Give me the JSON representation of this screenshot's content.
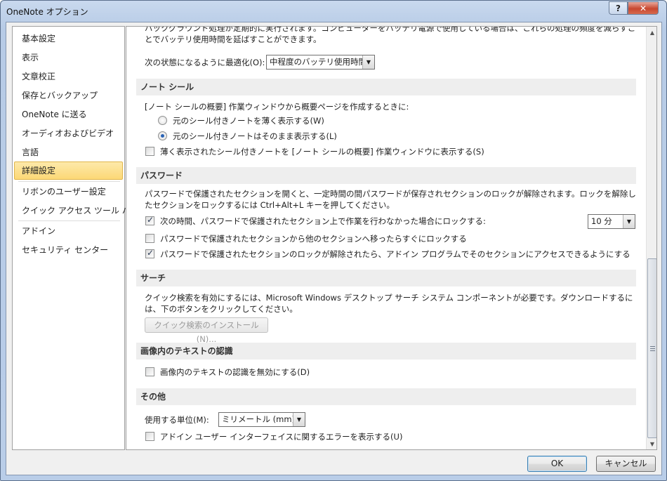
{
  "window": {
    "title": "OneNote オプション",
    "help_label": "?",
    "close_label": "✕"
  },
  "sidebar": {
    "items": [
      {
        "label": "基本設定"
      },
      {
        "label": "表示"
      },
      {
        "label": "文章校正"
      },
      {
        "label": "保存とバックアップ"
      },
      {
        "label": "OneNote に送る"
      },
      {
        "label": "オーディオおよびビデオ"
      },
      {
        "label": "言語"
      },
      {
        "label": "詳細設定",
        "selected": true
      },
      {
        "label": "リボンのユーザー設定"
      },
      {
        "label": "クイック アクセス ツール バー"
      },
      {
        "label": "アドイン"
      },
      {
        "label": "セキュリティ センター"
      }
    ]
  },
  "battery": {
    "partial_text": "バックグラウンド処理が定期的に実行されます。コンピューターをバッテリ電源で使用している場合は、これらの処理の頻度を減らすことでバッテリ使用時間を延ばすことができます。",
    "optimize_label": "次の状態になるように最適化(O):",
    "optimize_value": "中程度のバッテリ使用時間"
  },
  "note_seal": {
    "header": "ノート シール",
    "intro": "[ノート シールの概要] 作業ウィンドウから概要ページを作成するときに:",
    "radio_dim_label": "元のシール付きノートを薄く表示する(W)",
    "radio_keep_label": "元のシール付きノートはそのまま表示する(L)",
    "show_dimmed_label": "薄く表示されたシール付きノートを [ノート シールの概要] 作業ウィンドウに表示する(S)"
  },
  "password": {
    "header": "パスワード",
    "desc": "パスワードで保護されたセクションを開くと、一定時間の間パスワードが保存されセクションのロックが解除されます。ロックを解除したセクションをロックするには Ctrl+Alt+L キーを押してください。",
    "lock_after_label": "次の時間、パスワードで保護されたセクション上で作業を行わなかった場合にロックする:",
    "lock_after_value": "10 分",
    "lock_on_leave_label": "パスワードで保護されたセクションから他のセクションへ移ったらすぐにロックする",
    "addin_access_label": "パスワードで保護されたセクションのロックが解除されたら、アドイン プログラムでそのセクションにアクセスできるようにする"
  },
  "search": {
    "header": "サーチ",
    "desc": "クイック検索を有効にするには、Microsoft Windows デスクトップ サーチ システム コンポーネントが必要です。ダウンロードするには、下のボタンをクリックしてください。",
    "install_button": "クイック検索のインストール(N)..."
  },
  "ocr": {
    "header": "画像内のテキストの認識",
    "disable_label": "画像内のテキストの認識を無効にする(D)"
  },
  "other": {
    "header": "その他",
    "units_label": "使用する単位(M):",
    "units_value": "ミリメートル (mm)",
    "addin_errors_label": "アドイン ユーザー インターフェイスに関するエラーを表示する(U)"
  },
  "footer": {
    "ok_label": "OK",
    "cancel_label": "キャンセル"
  },
  "icons": {
    "dropdown": "▼",
    "scroll_up": "▲",
    "scroll_down": "▼"
  }
}
